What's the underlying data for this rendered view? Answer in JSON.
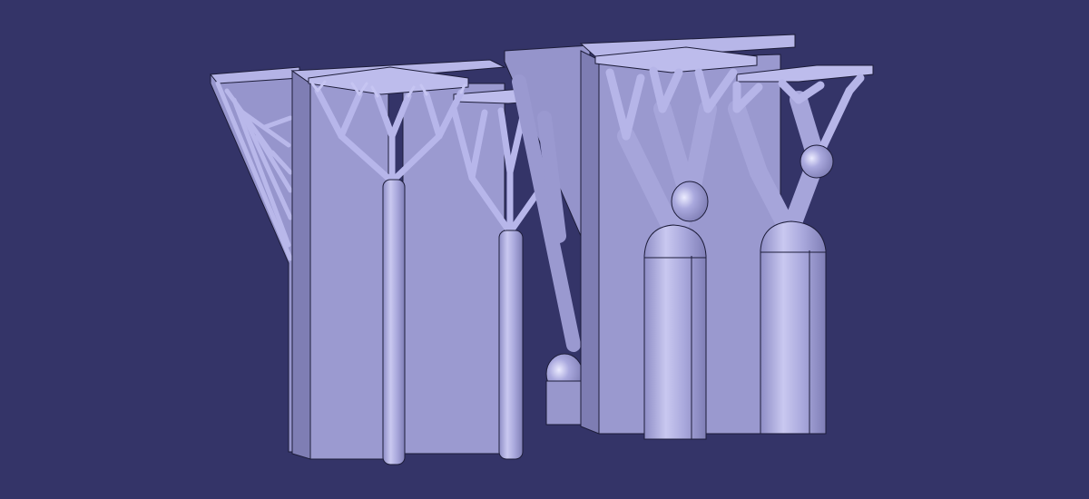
{
  "viewport": {
    "background": "#343468",
    "model_fill": "#a7a6dc",
    "model_shade": "#8f8ec6",
    "model_dark": "#7473a8",
    "model_light": "#c8c8ef",
    "edge_color": "#1d1d3a"
  },
  "scene": {
    "objects": [
      {
        "name": "left-part",
        "support_style": "thin-branching-tree-supports"
      },
      {
        "name": "right-part",
        "support_style": "thick-branching-tree-supports"
      }
    ]
  }
}
